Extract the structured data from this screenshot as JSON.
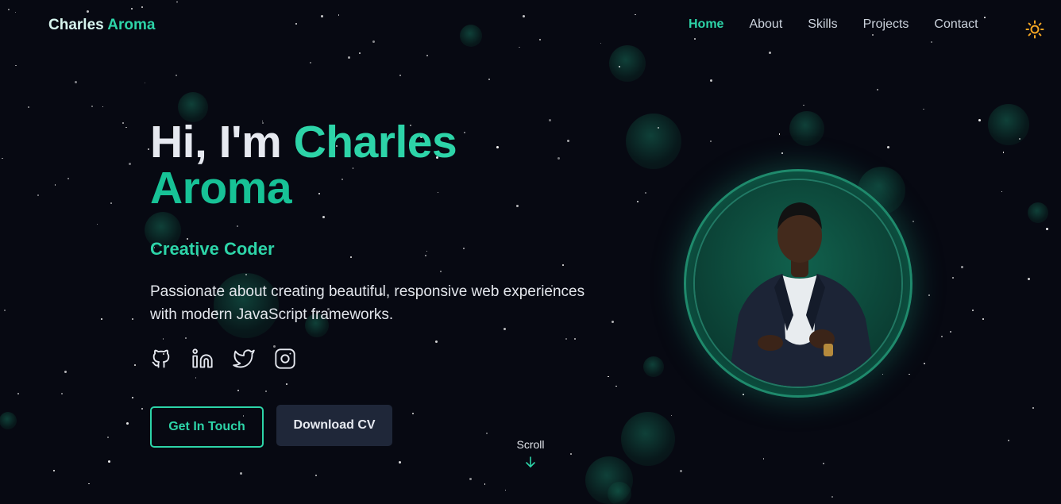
{
  "header": {
    "brand_first": "Charles",
    "brand_last": "Aroma",
    "nav": [
      {
        "label": "Home",
        "active": true
      },
      {
        "label": "About",
        "active": false
      },
      {
        "label": "Skills",
        "active": false
      },
      {
        "label": "Projects",
        "active": false
      },
      {
        "label": "Contact",
        "active": false
      }
    ],
    "theme_toggle_icon": "sun-icon"
  },
  "hero": {
    "greeting": "Hi, I'm",
    "name_first": "Charles",
    "name_last": "Aroma",
    "role": "Creative Coder",
    "description": "Passionate about creating beautiful, responsive web experiences with modern JavaScript frameworks.",
    "socials": [
      "github-icon",
      "linkedin-icon",
      "twitter-icon",
      "instagram-icon"
    ],
    "primary_button": "Get In Touch",
    "secondary_button": "Download CV"
  },
  "scroll_hint": {
    "label": "Scroll",
    "icon": "arrow-down-icon"
  },
  "colors": {
    "background": "#070912",
    "accent": "#2dd4a8",
    "button_dark": "#1f2739",
    "theme_icon": "#f5a623"
  }
}
